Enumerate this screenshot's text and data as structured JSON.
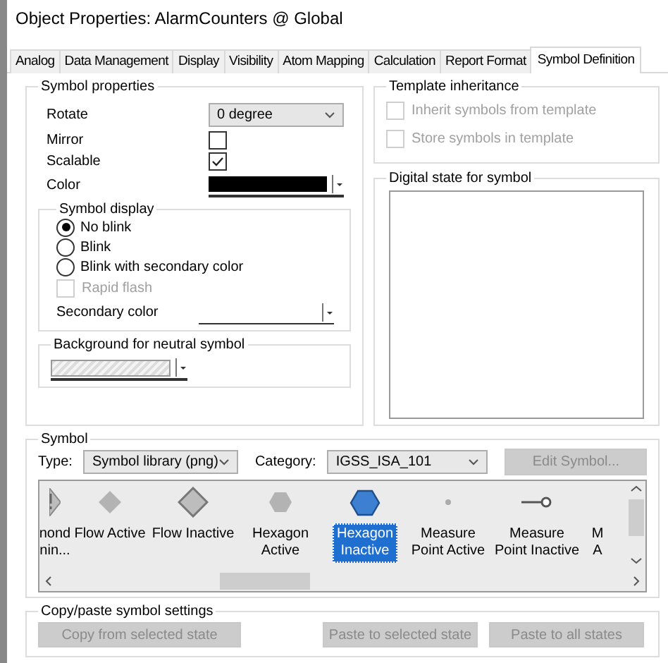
{
  "window": {
    "title": "Object Properties: AlarmCounters @ Global"
  },
  "tabs": [
    {
      "label": "Analog",
      "selected": false
    },
    {
      "label": "Data Management",
      "selected": false
    },
    {
      "label": "Display",
      "selected": false
    },
    {
      "label": "Visibility",
      "selected": false
    },
    {
      "label": "Atom Mapping",
      "selected": false
    },
    {
      "label": "Calculation",
      "selected": false
    },
    {
      "label": "Report Format",
      "selected": false
    },
    {
      "label": "Symbol Definition",
      "selected": true
    }
  ],
  "symbol_properties": {
    "title": "Symbol properties",
    "rotate": {
      "label": "Rotate",
      "value": "0 degree"
    },
    "mirror": {
      "label": "Mirror",
      "checked": false
    },
    "scalable": {
      "label": "Scalable",
      "checked": true
    },
    "color": {
      "label": "Color"
    }
  },
  "symbol_display": {
    "title": "Symbol display",
    "options": [
      {
        "label": "No blink",
        "selected": true
      },
      {
        "label": "Blink",
        "selected": false
      },
      {
        "label": "Blink with secondary color",
        "selected": false
      }
    ],
    "rapid_flash": {
      "label": "Rapid flash",
      "checked": false,
      "disabled": true
    },
    "secondary_color": {
      "label": "Secondary color"
    }
  },
  "background": {
    "title": "Background for neutral symbol"
  },
  "template_inheritance": {
    "title": "Template inheritance",
    "options": [
      {
        "label": "Inherit symbols from template",
        "checked": false,
        "disabled": true
      },
      {
        "label": "Store symbols in template",
        "checked": false,
        "disabled": true
      }
    ]
  },
  "digital_state": {
    "title": "Digital state for symbol"
  },
  "symbol": {
    "title": "Symbol",
    "type": {
      "label": "Type:",
      "value": "Symbol library (png)"
    },
    "category": {
      "label": "Category:",
      "value": "IGSS_ISA_101"
    },
    "edit_button": {
      "label": "Edit Symbol...",
      "disabled": true
    },
    "items": [
      {
        "lines": [
          "nond",
          "nin..."
        ],
        "kind": "alert",
        "selected": false
      },
      {
        "lines": [
          "Flow Active"
        ],
        "kind": "small-diamond",
        "selected": false
      },
      {
        "lines": [
          "Flow Inactive"
        ],
        "kind": "large-diamond",
        "selected": false
      },
      {
        "lines": [
          "Hexagon",
          "Active"
        ],
        "kind": "small-hexagon",
        "selected": false
      },
      {
        "lines": [
          "Hexagon",
          "Inactive"
        ],
        "kind": "large-hexagon",
        "selected": true
      },
      {
        "lines": [
          "Measure",
          "Point Active"
        ],
        "kind": "dot",
        "selected": false
      },
      {
        "lines": [
          "Measure",
          "Point Inactive"
        ],
        "kind": "pin",
        "selected": false
      },
      {
        "lines": [
          "M",
          "A"
        ],
        "kind": "none",
        "selected": false
      }
    ]
  },
  "copy_paste": {
    "title": "Copy/paste symbol settings",
    "buttons": [
      {
        "label": "Copy from selected state",
        "disabled": true
      },
      {
        "label": "Paste to selected state",
        "disabled": true
      },
      {
        "label": "Paste to all states",
        "disabled": true
      }
    ]
  }
}
